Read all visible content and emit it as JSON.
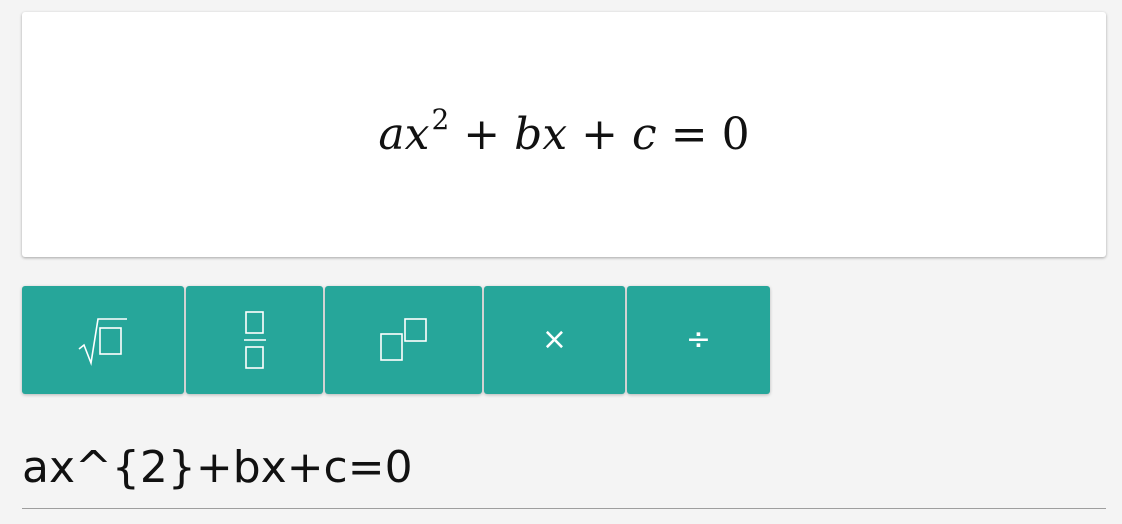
{
  "display": {
    "coef_a": "a",
    "var_x1": "x",
    "exponent": "2",
    "plus1": "+",
    "coef_b": "b",
    "var_x2": "x",
    "plus2": "+",
    "const_c": "c",
    "equals": "=",
    "rhs": "0"
  },
  "toolbar": {
    "buttons": [
      {
        "name": "sqrt",
        "icon": "sqrt-icon"
      },
      {
        "name": "fraction",
        "icon": "fraction-icon"
      },
      {
        "name": "superscript",
        "icon": "superscript-icon"
      },
      {
        "name": "times",
        "glyph": "×"
      },
      {
        "name": "divide",
        "glyph": "÷"
      }
    ],
    "accent": "#26a69a"
  },
  "input": {
    "value": "ax^{2}+bx+c=0"
  }
}
